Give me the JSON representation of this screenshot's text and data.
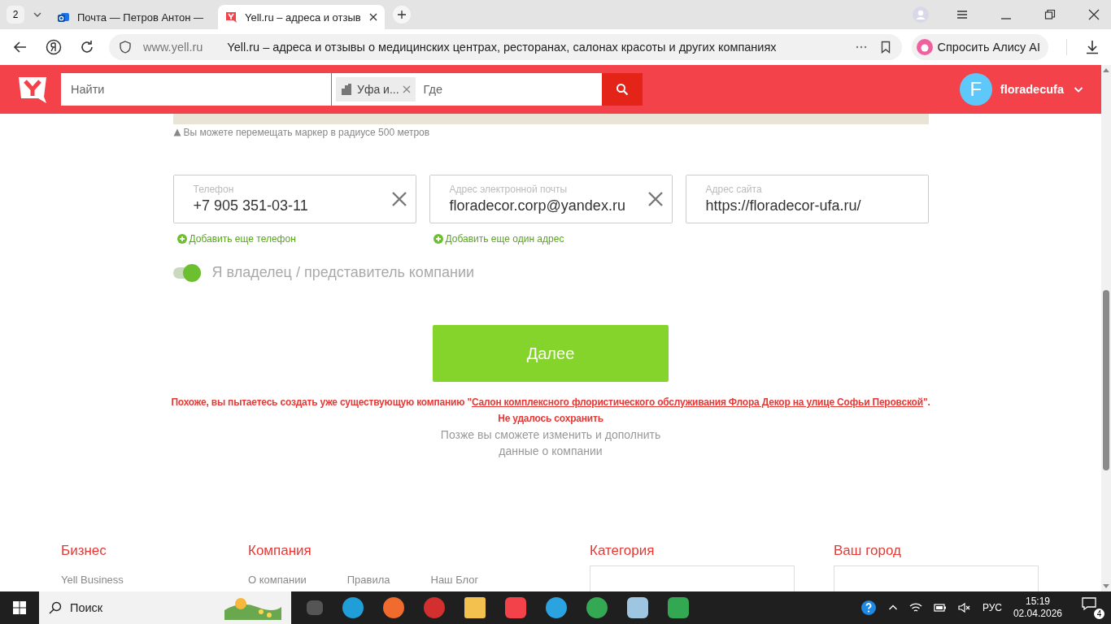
{
  "browser": {
    "tab_count": "2",
    "tabs": [
      {
        "kind": "mail",
        "title": "Почта — Петров Антон —",
        "selected": false
      },
      {
        "kind": "yell",
        "title": "Yell.ru – адреса и отзыв",
        "selected": true
      }
    ],
    "address": {
      "domain": "www.yell.ru",
      "title": "Yell.ru – адреса и отзывы о медицинских центрах, ресторанах, салонах красоты и других компаниях"
    },
    "alice_button": "Спросить Алису AI"
  },
  "site_header": {
    "search_placeholder": "Найти",
    "location_chip": "Уфа и...",
    "where_placeholder": "Где",
    "user": {
      "initial": "F",
      "name": "floradecufa"
    }
  },
  "map_hint": "Вы можете перемещать маркер в радиусе 500 метров",
  "fields": [
    {
      "label": "Телефон",
      "value": "+7 905 351-03-11",
      "clearable": true
    },
    {
      "label": "Адрес электронной почты",
      "value": "floradecor.corp@yandex.ru",
      "clearable": true
    },
    {
      "label": "Адрес сайта",
      "value": "https://floradecor-ufa.ru/",
      "clearable": false
    }
  ],
  "add_links": [
    "Добавить еще телефон",
    "Добавить еще один адрес"
  ],
  "owner_toggle": {
    "label": "Я владелец / представитель компании",
    "on": true
  },
  "next_button": "Далее",
  "error": {
    "prefix": "Похоже, вы пытаетесь создать уже существующую компанию \"",
    "link": "Салон комплексного флористического обслуживания Флора Декор на улице Софьи Перовской",
    "suffix": "\".",
    "save_error": "Не удалось сохранить"
  },
  "note": [
    "Позже вы сможете изменить и дополнить",
    "данные о компании"
  ],
  "footer": [
    {
      "kind": "links",
      "heading": "Бизнес",
      "links": [
        "Yell Business"
      ]
    },
    {
      "kind": "links",
      "heading": "Компания",
      "links": [
        "О компании",
        "Правила",
        "Наш Блог"
      ]
    },
    {
      "kind": "select",
      "heading": "Категория"
    },
    {
      "kind": "select",
      "heading": "Ваш город"
    }
  ],
  "taskbar": {
    "search": "Поиск",
    "language": "РУС",
    "time": "15:19",
    "date": "02.04.2026",
    "notifications": "4"
  }
}
